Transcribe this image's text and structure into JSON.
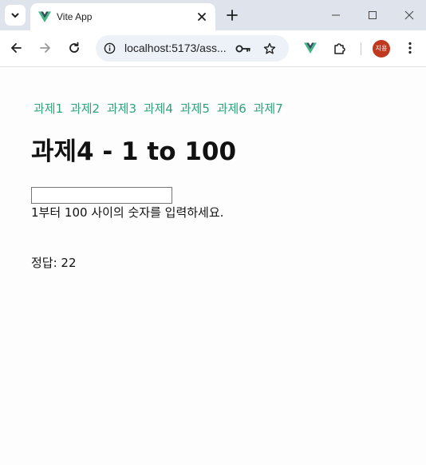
{
  "browser": {
    "tab": {
      "title": "Vite App",
      "favicon": "vue-logo-icon"
    },
    "address_bar": {
      "url": "localhost:5173/ass..."
    },
    "profile": {
      "initials": "지용",
      "color": "#c0391f"
    },
    "colors": {
      "tab_strip": "#dfe3eb",
      "omnibox": "#edf1f8",
      "vue_green": "#41b883",
      "vue_dark": "#35495e"
    },
    "icons": [
      "tab-search-icon",
      "close-icon",
      "new-tab-icon",
      "minimize-icon",
      "maximize-icon",
      "window-close-icon",
      "back-icon",
      "forward-icon",
      "reload-icon",
      "site-info-icon",
      "key-icon",
      "star-icon",
      "vue-devtools-icon",
      "extensions-icon",
      "menu-icon"
    ]
  },
  "page": {
    "nav_links": [
      "과제1",
      "과제2",
      "과제3",
      "과제4",
      "과제5",
      "과제6",
      "과제7"
    ],
    "title": "과제4 - 1 to 100",
    "input": {
      "value": "",
      "placeholder": ""
    },
    "hint": "1부터 100 사이의 숫자를 입력하세요.",
    "answer": "정답: 22",
    "colors": {
      "link": "#2fa37b",
      "text": "#111111",
      "background": "#fdfdfd"
    }
  }
}
